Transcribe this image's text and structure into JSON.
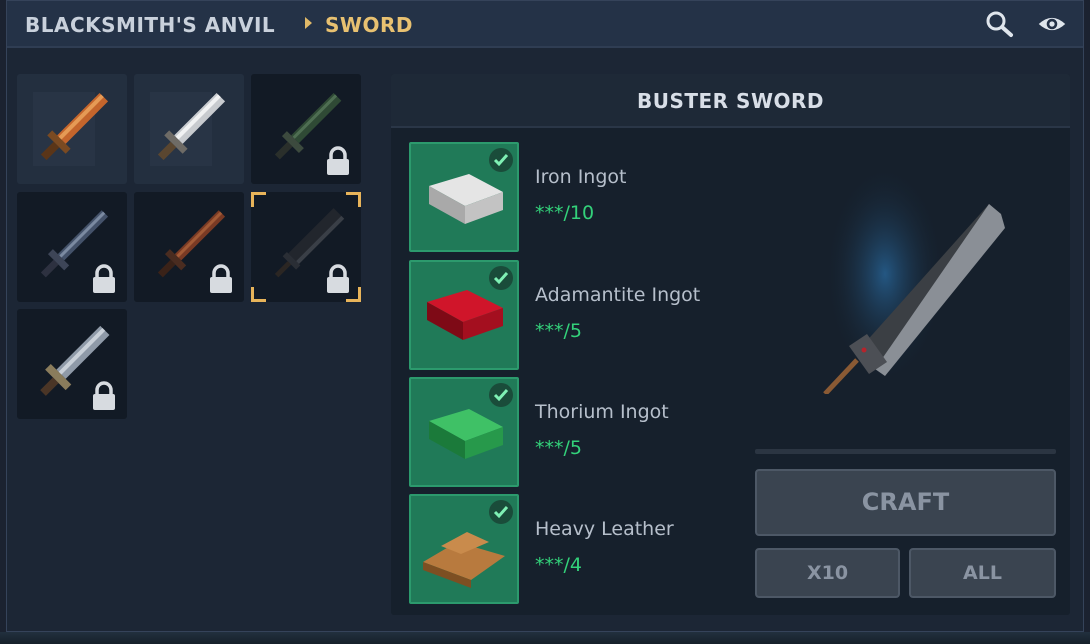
{
  "header": {
    "breadcrumb_root": "BLACKSMITH'S ANVIL",
    "breadcrumb_current": "SWORD",
    "icons": [
      "search-icon",
      "eye-icon"
    ]
  },
  "items": [
    {
      "name": "copper-sword",
      "locked": false,
      "selected": false
    },
    {
      "name": "iron-sword",
      "locked": false,
      "selected": false
    },
    {
      "name": "thorium-sword",
      "locked": true,
      "selected": false
    },
    {
      "name": "dark-blade",
      "locked": true,
      "selected": false
    },
    {
      "name": "crimson-blade",
      "locked": true,
      "selected": false
    },
    {
      "name": "buster-sword",
      "locked": true,
      "selected": true
    },
    {
      "name": "steel-sword",
      "locked": true,
      "selected": false
    }
  ],
  "recipe": {
    "title": "BUSTER SWORD",
    "ingredients": [
      {
        "name": "Iron Ingot",
        "qty": "***/10",
        "color": "#cfcfcf"
      },
      {
        "name": "Adamantite Ingot",
        "qty": "***/5",
        "color": "#b01020"
      },
      {
        "name": "Thorium Ingot",
        "qty": "***/5",
        "color": "#2aa548"
      },
      {
        "name": "Heavy Leather",
        "qty": "***/4",
        "color": "#b87a3e"
      }
    ],
    "craft_progress": 0,
    "buttons": {
      "craft": "CRAFT",
      "x10": "X10",
      "all": "ALL"
    }
  },
  "colors": {
    "accent": "#e8c171",
    "available": "#33d17a",
    "slot_green": "#207a58"
  }
}
